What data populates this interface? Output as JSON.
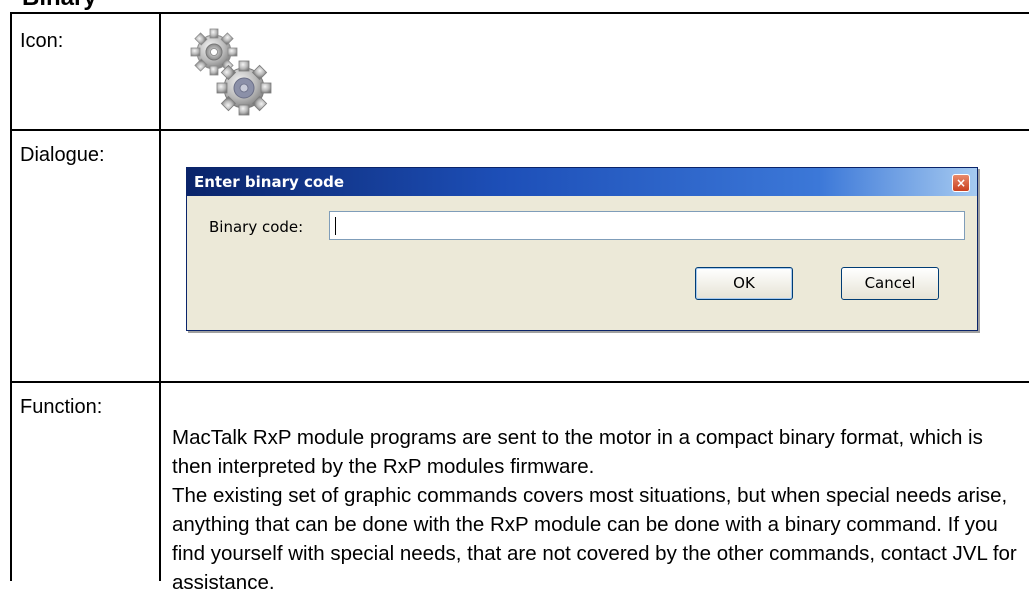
{
  "section_heading": "Binary",
  "rows": {
    "icon_label": "Icon:",
    "dialogue_label": "Dialogue:",
    "function_label": "Function:"
  },
  "icon": {
    "name": "gears-icon"
  },
  "dialog": {
    "title": "Enter binary code",
    "field_label": "Binary code:",
    "field_value": "",
    "ok_label": "OK",
    "cancel_label": "Cancel",
    "close_glyph": "×",
    "title_color": "#0a246a",
    "face_color": "#ece9d8"
  },
  "function_text": {
    "para1": "MacTalk RxP module programs are sent to the motor in a compact binary format, which is then interpreted by the RxP modules firmware.",
    "para2": "The existing set of graphic commands covers most situations, but when special needs arise, anything that can be done with the RxP module can be done with a binary command. If you find yourself with special needs, that are not covered by the other commands, contact JVL for assistance."
  }
}
